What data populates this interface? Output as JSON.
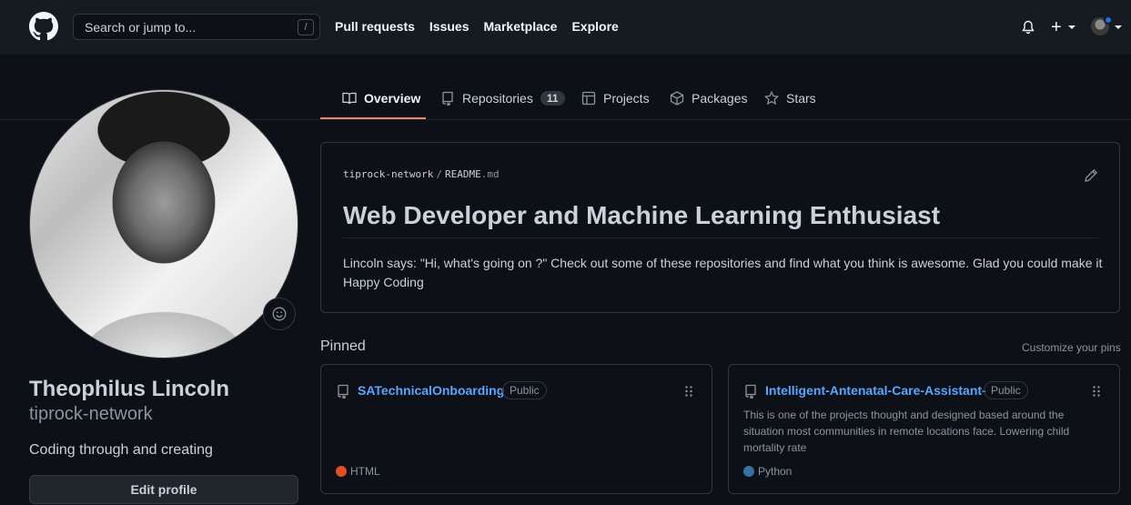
{
  "header": {
    "search_placeholder": "Search or jump to...",
    "search_shortcut": "/",
    "nav": [
      "Pull requests",
      "Issues",
      "Marketplace",
      "Explore"
    ],
    "create_label": "+"
  },
  "tabs": [
    {
      "label": "Overview",
      "icon": "book-icon",
      "selected": true
    },
    {
      "label": "Repositories",
      "icon": "repo-icon",
      "count": "11"
    },
    {
      "label": "Projects",
      "icon": "table-icon"
    },
    {
      "label": "Packages",
      "icon": "package-icon"
    },
    {
      "label": "Stars",
      "icon": "star-icon"
    }
  ],
  "profile": {
    "full_name": "Theophilus Lincoln",
    "username": "tiprock-network",
    "bio": "Coding through and creating",
    "edit_label": "Edit profile"
  },
  "readme": {
    "owner": "tiprock-network",
    "separator": "/",
    "file_base": "README",
    "file_ext": ".md",
    "title": "Web Developer and Machine Learning Enthusiast",
    "text_line1": "Lincoln says: \"Hi, what's going on ?\" Check out some of these repositories and find what you think is awesome. Glad you could make it",
    "text_line2": "Happy Coding"
  },
  "pinned": {
    "label": "Pinned",
    "customize_label": "Customize your pins",
    "items": [
      {
        "name": "SATechnicalOnboarding",
        "visibility": "Public",
        "description": "",
        "language": "HTML",
        "language_color": "#e34c26"
      },
      {
        "name": "Intelligent-Antenatal-Care-Assistant-",
        "visibility": "Public",
        "description": "This is one of the projects thought and designed based around the situation most communities in remote locations face. Lowering child mortality rate",
        "language": "Python",
        "language_color": "#3572A5"
      }
    ]
  },
  "colors": {
    "accent": "#f78166",
    "link": "#58a6ff",
    "background": "#0d1117"
  }
}
